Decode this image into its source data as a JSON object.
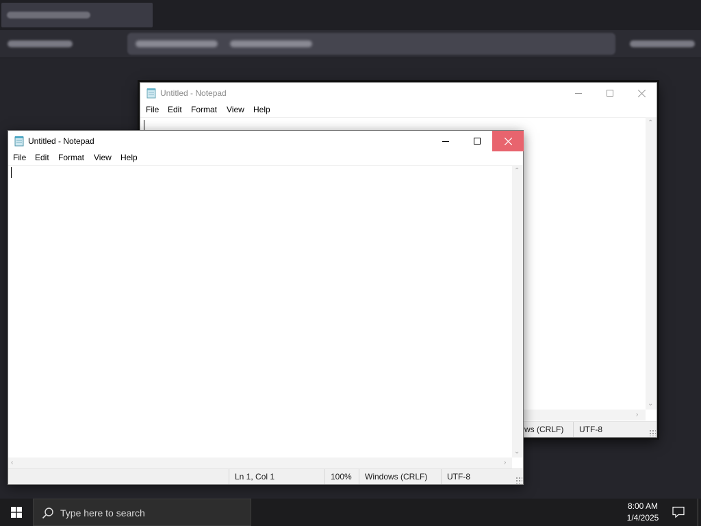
{
  "background_app": {
    "note_colors": {
      "accent": "#3a3a44"
    }
  },
  "back_window": {
    "title": "Untitled - Notepad",
    "menu": [
      "File",
      "Edit",
      "Format",
      "View",
      "Help"
    ],
    "status": {
      "line_ending": "ws (CRLF)",
      "encoding": "UTF-8"
    }
  },
  "front_window": {
    "title": "Untitled - Notepad",
    "menu": [
      "File",
      "Edit",
      "Format",
      "View",
      "Help"
    ],
    "status": {
      "position": "Ln 1, Col 1",
      "zoom": "100%",
      "line_ending": "Windows (CRLF)",
      "encoding": "UTF-8"
    },
    "close_hover_color": "#e8646e"
  },
  "taskbar": {
    "search_placeholder": "Type here to search",
    "time": "8:00 AM",
    "date": "1/4/2025",
    "icons": [
      "windows-start-icon",
      "search-icon",
      "notification-icon"
    ]
  }
}
